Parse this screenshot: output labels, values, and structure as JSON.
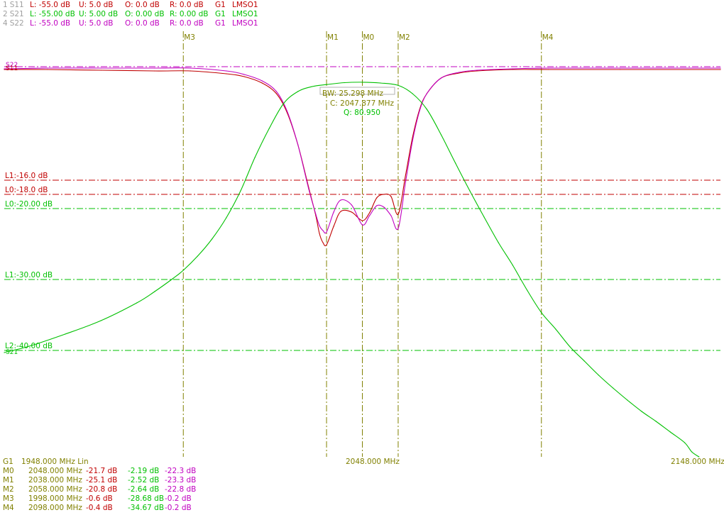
{
  "colors": {
    "s11": "#c00000",
    "s21": "#00c000",
    "s22": "#c000c0",
    "marker": "#808000",
    "text_dim": "#a0a0a0"
  },
  "traces": [
    {
      "idx": "1",
      "name": "S11",
      "color": "#c00000",
      "L": "L: -55.0 dB",
      "U": "U: 5.0 dB",
      "O": "O: 0.0 dB",
      "R": "R: 0.0 dB",
      "G": "G1",
      "src": "LMSO1"
    },
    {
      "idx": "2",
      "name": "S21",
      "color": "#00c000",
      "L": "L: -55.00 dB",
      "U": "U: 5.00 dB",
      "O": "O: 0.00 dB",
      "R": "R: 0.00 dB",
      "G": "G1",
      "src": "LMSO1"
    },
    {
      "idx": "4",
      "name": "S22",
      "color": "#c000c0",
      "L": "L: -55.0 dB",
      "U": "U: 5.0 dB",
      "O": "O: 0.0 dB",
      "R": "R: 0.0 dB",
      "G": "G1",
      "src": "LMSO1"
    }
  ],
  "freq_axis": {
    "group": "G1",
    "start_label": "1948.000 MHz Lin",
    "center_label": "2048.000 MHz",
    "stop_label": "2148.000 MHz"
  },
  "bw_info": {
    "bw": "BW:  25.298 MHz",
    "center": "C: 2047.877 MHz",
    "q": "Q:  80.950"
  },
  "marker_table": [
    {
      "name": "M0",
      "freq": "2048.000 MHz",
      "s11": "-21.7 dB",
      "s21": "-2.19 dB",
      "s22": "-22.3 dB"
    },
    {
      "name": "M1",
      "freq": "2038.000 MHz",
      "s11": "-25.1 dB",
      "s21": "-2.52 dB",
      "s22": "-23.3 dB"
    },
    {
      "name": "M2",
      "freq": "2058.000 MHz",
      "s11": "-20.8 dB",
      "s21": "-2.64 dB",
      "s22": "-22.8 dB"
    },
    {
      "name": "M3",
      "freq": "1998.000 MHz",
      "s11": "-0.6 dB",
      "s21": "-28.68 dB",
      "s22": "-0.2 dB"
    },
    {
      "name": "M4",
      "freq": "2098.000 MHz",
      "s11": "-0.4 dB",
      "s21": "-34.67 dB",
      "s22": "-0.2 dB"
    }
  ],
  "chart_data": {
    "type": "line",
    "xlim": [
      1948,
      2148
    ],
    "ylim": [
      -55,
      5
    ],
    "xunit": "MHz",
    "yunit": "dB",
    "markers": [
      {
        "name": "M3",
        "x": 1998
      },
      {
        "name": "M1",
        "x": 2038
      },
      {
        "name": "M0",
        "x": 2048
      },
      {
        "name": "M2",
        "x": 2058
      },
      {
        "name": "M4",
        "x": 2098
      }
    ],
    "limit_lines": [
      {
        "label": "L1:-16.0 dB",
        "y": -16.0,
        "color": "#c00000"
      },
      {
        "label": "L0:-18.0 dB",
        "y": -18.0,
        "color": "#c00000"
      },
      {
        "label": "L0:-20.00 dB",
        "y": -20.0,
        "color": "#00c000"
      },
      {
        "label": "L1:-30.00 dB",
        "y": -30.0,
        "color": "#00c000"
      },
      {
        "label": "L2:-40.00 dB",
        "y": -40.0,
        "color": "#00c000"
      }
    ],
    "ref_labels": [
      {
        "text": "S22",
        "y": 0.3,
        "color": "#c000c0"
      },
      {
        "text": "S11",
        "y": -0.2,
        "color": "#c00000"
      },
      {
        "text": "S21",
        "y": -40.2,
        "color": "#00c000"
      }
    ],
    "series": [
      {
        "name": "S11",
        "color": "#c00000",
        "x": [
          1948,
          1960,
          1975,
          1990,
          2000,
          2010,
          2015,
          2020,
          2024,
          2027,
          2030,
          2033,
          2035,
          2036,
          2037,
          2038,
          2040,
          2042,
          2045,
          2048,
          2050,
          2052,
          2054,
          2056,
          2058,
          2060,
          2062,
          2064,
          2066,
          2070,
          2075,
          2080,
          2090,
          2100,
          2120,
          2148
        ],
        "y": [
          -0.4,
          -0.4,
          -0.5,
          -0.6,
          -0.6,
          -1.0,
          -1.4,
          -2.3,
          -3.8,
          -6.5,
          -11.0,
          -17.0,
          -21.0,
          -23.5,
          -24.8,
          -25.1,
          -22.5,
          -20.4,
          -20.5,
          -21.7,
          -20.6,
          -18.5,
          -18.0,
          -18.3,
          -20.8,
          -15.5,
          -10.0,
          -6.0,
          -3.8,
          -1.6,
          -0.9,
          -0.6,
          -0.4,
          -0.4,
          -0.4,
          -0.4
        ]
      },
      {
        "name": "S22",
        "color": "#c000c0",
        "x": [
          1948,
          1960,
          1975,
          1990,
          2000,
          2010,
          2015,
          2020,
          2024,
          2027,
          2030,
          2033,
          2035,
          2036,
          2037,
          2038,
          2040,
          2042,
          2045,
          2048,
          2050,
          2052,
          2054,
          2056,
          2058,
          2060,
          2062,
          2064,
          2066,
          2070,
          2075,
          2080,
          2090,
          2100,
          2120,
          2148
        ],
        "y": [
          -0.3,
          -0.2,
          -0.2,
          -0.2,
          -0.2,
          -0.6,
          -1.1,
          -2.0,
          -3.5,
          -6.3,
          -11.0,
          -17.2,
          -20.8,
          -22.4,
          -23.1,
          -23.3,
          -20.5,
          -18.8,
          -19.5,
          -22.3,
          -21.0,
          -19.6,
          -19.8,
          -21.0,
          -22.8,
          -16.5,
          -10.5,
          -6.2,
          -3.8,
          -1.6,
          -0.8,
          -0.5,
          -0.3,
          -0.2,
          -0.2,
          -0.2
        ]
      },
      {
        "name": "S21",
        "color": "#00c000",
        "x": [
          1948,
          1955,
          1965,
          1975,
          1985,
          1990,
          1995,
          1998,
          2002,
          2006,
          2010,
          2014,
          2018,
          2022,
          2026,
          2030,
          2034,
          2038,
          2043,
          2048,
          2053,
          2058,
          2062,
          2066,
          2070,
          2074,
          2078,
          2082,
          2086,
          2090,
          2094,
          2098,
          2102,
          2106,
          2110,
          2114,
          2118,
          2122,
          2126,
          2130,
          2134,
          2138,
          2140,
          2142
        ],
        "y": [
          -40.3,
          -39.4,
          -37.7,
          -35.8,
          -33.3,
          -31.7,
          -29.9,
          -28.7,
          -26.7,
          -24.3,
          -21.3,
          -17.5,
          -12.8,
          -8.7,
          -5.2,
          -3.5,
          -2.8,
          -2.52,
          -2.25,
          -2.19,
          -2.3,
          -2.64,
          -3.8,
          -6.0,
          -9.6,
          -13.6,
          -17.5,
          -21.2,
          -24.8,
          -28.0,
          -31.5,
          -34.67,
          -37.0,
          -39.5,
          -41.5,
          -43.5,
          -45.3,
          -47.0,
          -48.6,
          -50.0,
          -51.5,
          -53.0,
          -54.3,
          -55.0
        ]
      }
    ]
  }
}
